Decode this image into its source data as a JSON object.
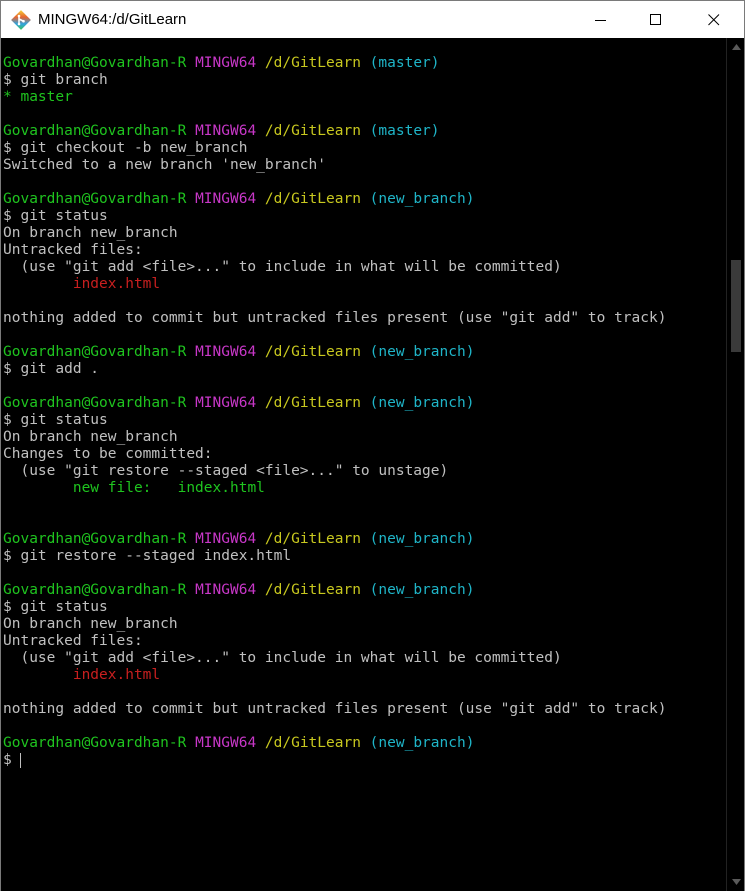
{
  "window": {
    "title": "MINGW64:/d/GitLearn",
    "icon": "git-bash-icon",
    "controls": [
      "minimize-icon",
      "maximize-icon",
      "close-icon"
    ]
  },
  "colors": {
    "user": "#1fc41f",
    "system": "#c837c8",
    "path": "#c8c81f",
    "branch": "#1fb5c8",
    "untracked": "#c81f1f",
    "staged": "#1fc41f",
    "text": "#c0c0c0"
  },
  "terminal": {
    "lines": [
      [
        {
          "t": "Govardhan@Govardhan-R",
          "c": "green"
        },
        {
          "t": " "
        },
        {
          "t": "MINGW64",
          "c": "magenta"
        },
        {
          "t": " "
        },
        {
          "t": "/d/GitLearn",
          "c": "yellow"
        },
        {
          "t": " "
        },
        {
          "t": "(master)",
          "c": "cyan"
        }
      ],
      [
        {
          "t": "$ git branch"
        }
      ],
      [
        {
          "t": "* master",
          "c": "green"
        }
      ],
      [],
      [
        {
          "t": "Govardhan@Govardhan-R",
          "c": "green"
        },
        {
          "t": " "
        },
        {
          "t": "MINGW64",
          "c": "magenta"
        },
        {
          "t": " "
        },
        {
          "t": "/d/GitLearn",
          "c": "yellow"
        },
        {
          "t": " "
        },
        {
          "t": "(master)",
          "c": "cyan"
        }
      ],
      [
        {
          "t": "$ git checkout -b new_branch"
        }
      ],
      [
        {
          "t": "Switched to a new branch 'new_branch'"
        }
      ],
      [],
      [
        {
          "t": "Govardhan@Govardhan-R",
          "c": "green"
        },
        {
          "t": " "
        },
        {
          "t": "MINGW64",
          "c": "magenta"
        },
        {
          "t": " "
        },
        {
          "t": "/d/GitLearn",
          "c": "yellow"
        },
        {
          "t": " "
        },
        {
          "t": "(new_branch)",
          "c": "cyan"
        }
      ],
      [
        {
          "t": "$ git status"
        }
      ],
      [
        {
          "t": "On branch new_branch"
        }
      ],
      [
        {
          "t": "Untracked files:"
        }
      ],
      [
        {
          "t": "  (use \"git add <file>...\" to include in what will be committed)"
        }
      ],
      [
        {
          "t": "        "
        },
        {
          "t": "index.html",
          "c": "red"
        }
      ],
      [],
      [
        {
          "t": "nothing added to commit but untracked files present (use \"git add\" to track)"
        }
      ],
      [],
      [
        {
          "t": "Govardhan@Govardhan-R",
          "c": "green"
        },
        {
          "t": " "
        },
        {
          "t": "MINGW64",
          "c": "magenta"
        },
        {
          "t": " "
        },
        {
          "t": "/d/GitLearn",
          "c": "yellow"
        },
        {
          "t": " "
        },
        {
          "t": "(new_branch)",
          "c": "cyan"
        }
      ],
      [
        {
          "t": "$ git add ."
        }
      ],
      [],
      [
        {
          "t": "Govardhan@Govardhan-R",
          "c": "green"
        },
        {
          "t": " "
        },
        {
          "t": "MINGW64",
          "c": "magenta"
        },
        {
          "t": " "
        },
        {
          "t": "/d/GitLearn",
          "c": "yellow"
        },
        {
          "t": " "
        },
        {
          "t": "(new_branch)",
          "c": "cyan"
        }
      ],
      [
        {
          "t": "$ git status"
        }
      ],
      [
        {
          "t": "On branch new_branch"
        }
      ],
      [
        {
          "t": "Changes to be committed:"
        }
      ],
      [
        {
          "t": "  (use \"git restore --staged <file>...\" to unstage)"
        }
      ],
      [
        {
          "t": "        "
        },
        {
          "t": "new file:   index.html",
          "c": "green"
        }
      ],
      [],
      [],
      [
        {
          "t": "Govardhan@Govardhan-R",
          "c": "green"
        },
        {
          "t": " "
        },
        {
          "t": "MINGW64",
          "c": "magenta"
        },
        {
          "t": " "
        },
        {
          "t": "/d/GitLearn",
          "c": "yellow"
        },
        {
          "t": " "
        },
        {
          "t": "(new_branch)",
          "c": "cyan"
        }
      ],
      [
        {
          "t": "$ git restore --staged index.html"
        }
      ],
      [],
      [
        {
          "t": "Govardhan@Govardhan-R",
          "c": "green"
        },
        {
          "t": " "
        },
        {
          "t": "MINGW64",
          "c": "magenta"
        },
        {
          "t": " "
        },
        {
          "t": "/d/GitLearn",
          "c": "yellow"
        },
        {
          "t": " "
        },
        {
          "t": "(new_branch)",
          "c": "cyan"
        }
      ],
      [
        {
          "t": "$ git status"
        }
      ],
      [
        {
          "t": "On branch new_branch"
        }
      ],
      [
        {
          "t": "Untracked files:"
        }
      ],
      [
        {
          "t": "  (use \"git add <file>...\" to include in what will be committed)"
        }
      ],
      [
        {
          "t": "        "
        },
        {
          "t": "index.html",
          "c": "red"
        }
      ],
      [],
      [
        {
          "t": "nothing added to commit but untracked files present (use \"git add\" to track)"
        }
      ],
      [],
      [
        {
          "t": "Govardhan@Govardhan-R",
          "c": "green"
        },
        {
          "t": " "
        },
        {
          "t": "MINGW64",
          "c": "magenta"
        },
        {
          "t": " "
        },
        {
          "t": "/d/GitLearn",
          "c": "yellow"
        },
        {
          "t": " "
        },
        {
          "t": "(new_branch)",
          "c": "cyan"
        }
      ]
    ],
    "prompt_symbol": "$"
  }
}
